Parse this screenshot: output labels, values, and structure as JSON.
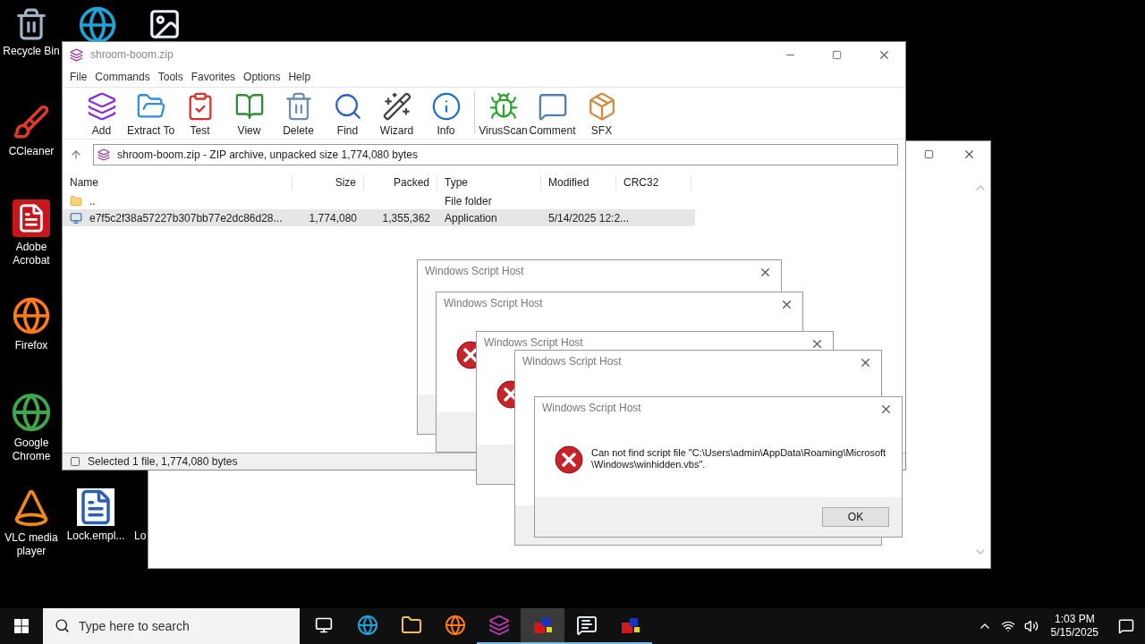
{
  "desktop_icons": [
    {
      "kind": "recycle",
      "label": "Recycle Bin"
    },
    {
      "kind": "edge"
    },
    {
      "kind": "image"
    },
    {
      "kind": "ccleaner",
      "label": "CCleaner"
    },
    {
      "kind": "acrobat",
      "label": "Adobe Acrobat"
    },
    {
      "kind": "firefox",
      "label": "Firefox"
    },
    {
      "kind": "chrome",
      "label": "Google Chrome"
    },
    {
      "kind": "vlc",
      "label": "VLC media player"
    },
    {
      "kind": "word",
      "label": "Lock.empl..."
    },
    {
      "kind": "cut",
      "label": "Lo"
    }
  ],
  "winrar": {
    "title": "shroom-boom.zip",
    "menu": [
      "File",
      "Commands",
      "Tools",
      "Favorites",
      "Options",
      "Help"
    ],
    "toolbar": [
      {
        "kind": "add",
        "label": "Add"
      },
      {
        "kind": "extract",
        "label": "Extract To"
      },
      {
        "kind": "test",
        "label": "Test"
      },
      {
        "kind": "view",
        "label": "View"
      },
      {
        "kind": "delete",
        "label": "Delete"
      },
      {
        "kind": "find",
        "label": "Find"
      },
      {
        "kind": "wizard",
        "label": "Wizard"
      },
      {
        "kind": "info",
        "label": "Info"
      },
      {
        "kind": "virus",
        "label": "VirusScan"
      },
      {
        "kind": "comment",
        "label": "Comment"
      },
      {
        "kind": "sfx",
        "label": "SFX"
      }
    ],
    "address": "shroom-boom.zip - ZIP archive, unpacked size 1,774,080 bytes",
    "columns": [
      "Name",
      "Size",
      "Packed",
      "Type",
      "Modified",
      "CRC32"
    ],
    "rows": [
      {
        "kind": "folder",
        "name": "..",
        "size": "",
        "packed": "",
        "type": "File folder",
        "modified": "",
        "selected": false
      },
      {
        "kind": "app",
        "name": "e7f5c2f38a57227b307bb77e2dc86d28...",
        "size": "1,774,080",
        "packed": "1,355,362",
        "type": "Application",
        "modified": "5/14/2025 12:2...",
        "selected": true
      }
    ],
    "status": "Selected 1 file, 1,774,080 bytes"
  },
  "dialogs": [
    {
      "title": "Windows Script Host"
    },
    {
      "title": "Windows Script Host"
    },
    {
      "title": "Windows Script Host"
    },
    {
      "title": "Windows Script Host"
    },
    {
      "title": "Windows Script Host",
      "message": "Can not find script file \"C:\\Users\\admin\\AppData\\Roaming\\Microsoft\\Windows\\winhidden.vbs\".",
      "button": "OK"
    }
  ],
  "taskbar": {
    "search_placeholder": "Type here to search",
    "apps": [
      {
        "kind": "taskview",
        "running": false,
        "selected": false
      },
      {
        "kind": "edge",
        "running": false,
        "selected": false
      },
      {
        "kind": "explorer",
        "running": false,
        "selected": false
      },
      {
        "kind": "firefox",
        "running": false,
        "selected": false
      },
      {
        "kind": "winrar",
        "running": true,
        "selected": false
      },
      {
        "kind": "script",
        "running": true,
        "selected": true
      },
      {
        "kind": "window",
        "running": true,
        "selected": false
      },
      {
        "kind": "script",
        "running": true,
        "selected": false
      }
    ],
    "time": "1:03 PM",
    "date": "5/15/2025"
  }
}
